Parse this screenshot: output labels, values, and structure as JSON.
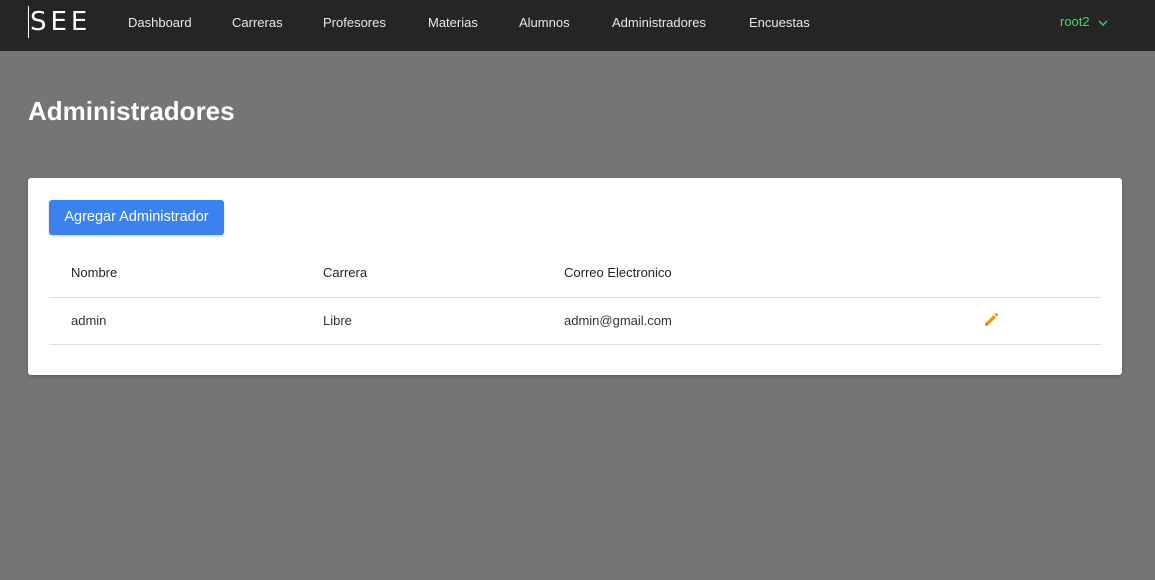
{
  "brand": "SEE",
  "nav": {
    "items": [
      {
        "label": "Dashboard"
      },
      {
        "label": "Carreras"
      },
      {
        "label": "Profesores"
      },
      {
        "label": "Materias"
      },
      {
        "label": "Alumnos"
      },
      {
        "label": "Administradores"
      },
      {
        "label": "Encuestas"
      }
    ],
    "user": "root2",
    "user_icon": "chevron-down-icon"
  },
  "page": {
    "title": "Administradores"
  },
  "card": {
    "add_button": "Agregar Administrador",
    "table": {
      "headers": [
        "Nombre",
        "Carrera",
        "Correo Electronico"
      ],
      "rows": [
        {
          "nombre": "admin",
          "carrera": "Libre",
          "correo": "admin@gmail.com",
          "action_icon": "pencil-icon"
        }
      ]
    }
  },
  "colors": {
    "navbar": "#252525",
    "background": "#757575",
    "accent": "#3b82f0",
    "user": "#3ddc6b",
    "edit_icon": "#e0a014"
  }
}
